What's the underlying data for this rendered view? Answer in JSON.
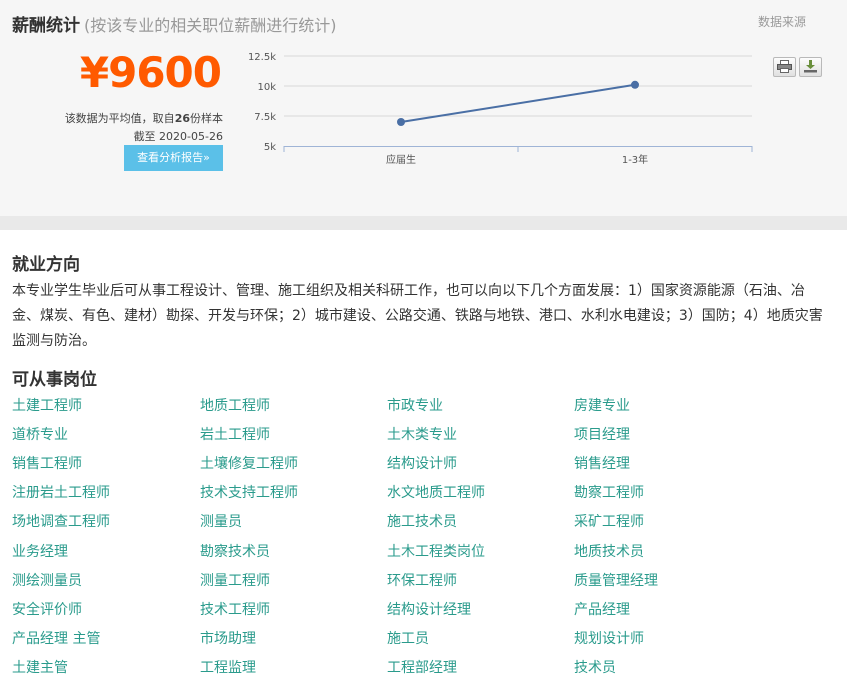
{
  "salary": {
    "title": "薪酬统计",
    "subtitle": "(按该专业的相关职位薪酬进行统计)",
    "source_link": "数据来源",
    "price": "¥9600",
    "note_prefix": "该数据为平均值，取自",
    "note_count": "26",
    "note_suffix": "份样本",
    "date_note": "截至 2020-05-26",
    "report_button": "查看分析报告»",
    "print_icon": "printer-icon",
    "download_icon": "download-icon"
  },
  "chart_data": {
    "type": "line",
    "categories": [
      "应届生",
      "1-3年"
    ],
    "values": [
      7000,
      10100
    ],
    "ylim": [
      5000,
      12500
    ],
    "yticks": [
      5000,
      7500,
      10000,
      12500
    ],
    "ytick_labels": [
      "5k",
      "7.5k",
      "10k",
      "12.5k"
    ],
    "grid": true,
    "line_color": "#4a6fa5"
  },
  "employment": {
    "title": "就业方向",
    "text": "本专业学生毕业后可从事工程设计、管理、施工组织及相关科研工作，也可以向以下几个方面发展：1）国家资源能源（石油、冶金、煤炭、有色、建材）勘探、开发与环保；2）城市建设、公路交通、铁路与地铁、港口、水利水电建设；3）国防；4）地质灾害监测与防治。"
  },
  "positions": {
    "title": "可从事岗位",
    "link_color": "#2a9b8c",
    "rows": [
      [
        "土建工程师",
        "地质工程师",
        "市政专业",
        "房建专业"
      ],
      [
        "道桥专业",
        "岩土工程师",
        "土木类专业",
        "项目经理"
      ],
      [
        "销售工程师",
        "土壤修复工程师",
        "结构设计师",
        "销售经理"
      ],
      [
        "注册岩土工程师",
        "技术支持工程师",
        "水文地质工程师",
        "勘察工程师"
      ],
      [
        "场地调查工程师",
        "测量员",
        "施工技术员",
        "采矿工程师"
      ],
      [
        "业务经理",
        "勘察技术员",
        "土木工程类岗位",
        "地质技术员"
      ],
      [
        "测绘测量员",
        "测量工程师",
        "环保工程师",
        "质量管理经理"
      ],
      [
        "安全评价师",
        "技术工程师",
        "结构设计经理",
        "产品经理"
      ],
      [
        "产品经理 主管",
        "市场助理",
        "施工员",
        "规划设计师"
      ],
      [
        "土建主管",
        "工程监理",
        "工程部经理",
        "技术员"
      ]
    ]
  }
}
